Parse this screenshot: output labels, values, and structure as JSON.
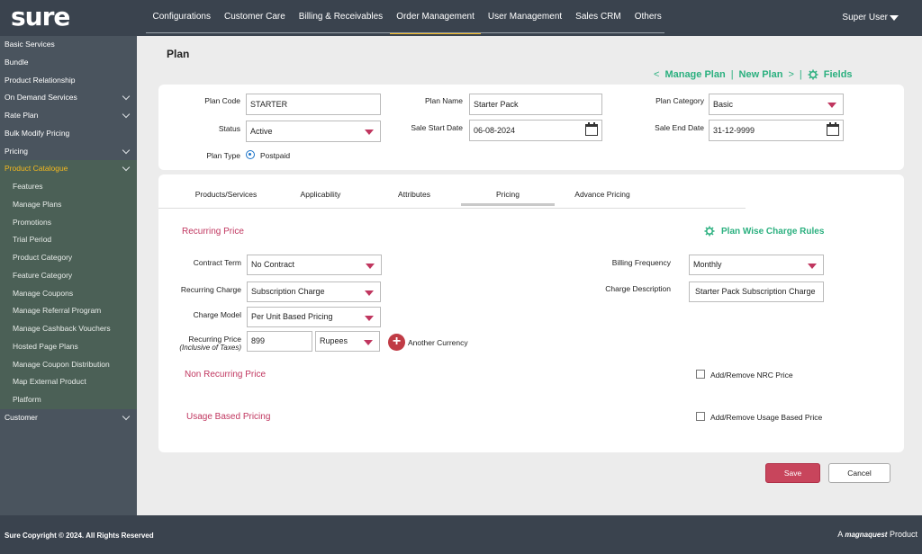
{
  "header": {
    "logo": "sure",
    "nav": [
      "Configurations",
      "Customer Care",
      "Billing & Receivables",
      "Order Management",
      "User Management",
      "Sales CRM",
      "Others"
    ],
    "active_nav": "Order Management",
    "user": "Super User"
  },
  "sidebar": {
    "items": [
      {
        "label": "Basic Services",
        "chevron": false
      },
      {
        "label": "Bundle",
        "chevron": false
      },
      {
        "label": "Product Relationship",
        "chevron": false
      },
      {
        "label": "On Demand Services",
        "chevron": true
      },
      {
        "label": "Rate Plan",
        "chevron": true
      },
      {
        "label": "Bulk Modify Pricing",
        "chevron": false
      },
      {
        "label": "Pricing",
        "chevron": true
      },
      {
        "label": "Product Catalogue",
        "chevron": true,
        "active": true
      },
      {
        "label": "Features",
        "sub": true
      },
      {
        "label": "Manage Plans",
        "sub": true
      },
      {
        "label": "Promotions",
        "sub": true
      },
      {
        "label": "Trial Period",
        "sub": true
      },
      {
        "label": "Product Category",
        "sub": true
      },
      {
        "label": "Feature Category",
        "sub": true
      },
      {
        "label": "Manage Coupons",
        "sub": true
      },
      {
        "label": "Manage Referral Program",
        "sub": true
      },
      {
        "label": "Manage Cashback Vouchers",
        "sub": true
      },
      {
        "label": "Hosted Page Plans",
        "sub": true
      },
      {
        "label": "Manage Coupon Distribution",
        "sub": true
      },
      {
        "label": "Map External Product",
        "sub": true
      },
      {
        "label": "Platform",
        "sub": true
      },
      {
        "label": "Customer",
        "chevron": true
      }
    ]
  },
  "page": {
    "title": "Plan",
    "breadcrumb": {
      "prev": "<",
      "manage": "Manage Plan",
      "sep1": "|",
      "new": "New Plan",
      "next": ">",
      "sep2": "|",
      "fields": "Fields"
    }
  },
  "plan_form": {
    "plan_code_label": "Plan Code",
    "plan_code": "STARTER",
    "plan_name_label": "Plan Name",
    "plan_name": "Starter Pack",
    "plan_category_label": "Plan Category",
    "plan_category": "Basic",
    "status_label": "Status",
    "status": "Active",
    "sale_start_label": "Sale Start Date",
    "sale_start": "06-08-2024",
    "sale_end_label": "Sale End Date",
    "sale_end": "31-12-9999",
    "plan_type_label": "Plan Type",
    "plan_type": "Postpaid"
  },
  "tabs": [
    "Products/Services",
    "Applicability",
    "Attributes",
    "Pricing",
    "Advance Pricing"
  ],
  "active_tab": "Pricing",
  "pricing": {
    "recurring_title": "Recurring Price",
    "charge_rules": "Plan Wise Charge Rules",
    "contract_term_label": "Contract Term",
    "contract_term": "No Contract",
    "recurring_charge_label": "Recurring Charge",
    "recurring_charge": "Subscription Charge",
    "charge_model_label": "Charge Model",
    "charge_model": "Per Unit Based Pricing",
    "recurring_price_label": "Recurring Price",
    "recurring_price_sub": "(Inclusive of Taxes)",
    "recurring_price": "899",
    "currency": "Rupees",
    "another_currency": "Another Currency",
    "billing_frequency_label": "Billing Frequency",
    "billing_frequency": "Monthly",
    "charge_description_label": "Charge Description",
    "charge_description": "Starter Pack Subscription Charge",
    "nrc_title": "Non Recurring Price",
    "nrc_checkbox": "Add/Remove NRC Price",
    "usage_title": "Usage Based Pricing",
    "usage_checkbox": "Add/Remove Usage Based Price"
  },
  "buttons": {
    "save": "Save",
    "cancel": "Cancel"
  },
  "footer": {
    "copyright": "Sure Copyright © 2024. All Rights Reserved",
    "powered_prefix": "A",
    "brand": "magnaquest",
    "powered_suffix": "Product"
  },
  "colors": {
    "accent_green": "#2bb07f",
    "accent_red": "#c0365f",
    "nav_active": "#f5b91e",
    "topbar": "#3a434e"
  }
}
